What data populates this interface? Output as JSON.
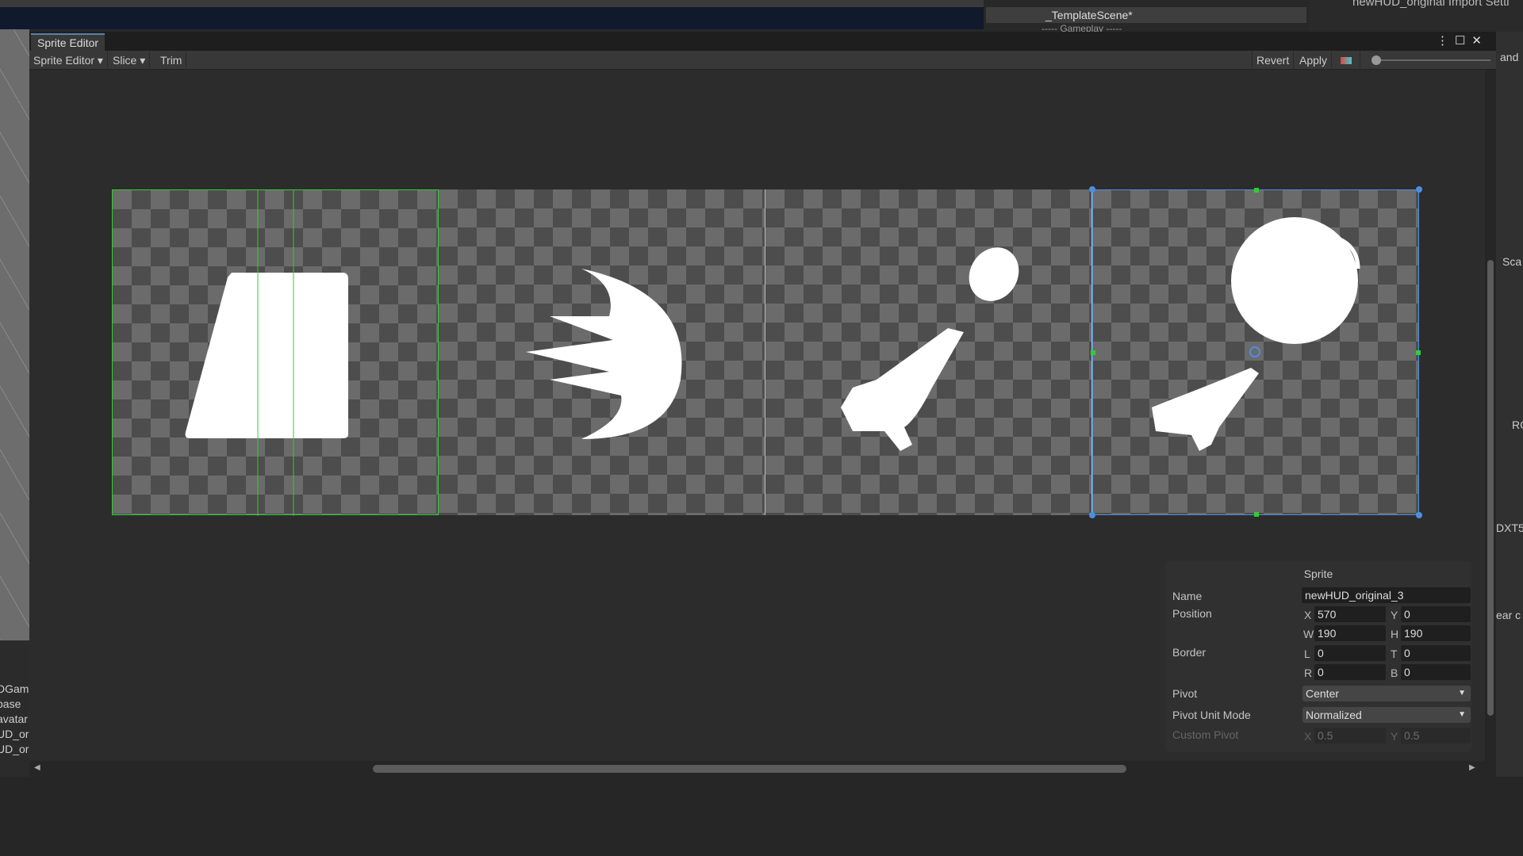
{
  "background": {
    "hierarchy_scene": "_TemplateScene*",
    "hierarchy_sub": "----- Gameplay -----",
    "inspector_title": "newHUD_original Import Setti",
    "project_items": [
      "DGam",
      "base",
      "avatar",
      "UD_or",
      "UD_or"
    ],
    "right_edge": [
      "and",
      "Sca",
      "RG",
      "DXT5",
      "ear c"
    ]
  },
  "window": {
    "tab_title": "Sprite Editor",
    "toolbar": {
      "mode": "Sprite Editor",
      "slice": "Slice",
      "trim": "Trim",
      "revert": "Revert",
      "apply": "Apply"
    },
    "zoom_level": 0
  },
  "sprite_panel": {
    "title": "Sprite",
    "name_label": "Name",
    "name": "newHUD_original_3",
    "position_label": "Position",
    "x": "570",
    "y": "0",
    "w": "190",
    "h": "190",
    "border_label": "Border",
    "l": "0",
    "t": "0",
    "r": "0",
    "b": "0",
    "pivot_label": "Pivot",
    "pivot": "Center",
    "pivot_unit_label": "Pivot Unit Mode",
    "pivot_unit": "Normalized",
    "custom_pivot_label": "Custom Pivot",
    "cx": "0.5",
    "cy": "0.5",
    "prefix": {
      "x": "X",
      "y": "Y",
      "w": "W",
      "h": "H",
      "l": "L",
      "t": "T",
      "r": "R",
      "b": "B"
    }
  },
  "colors": {
    "selection": "#4b8fe0",
    "outline": "#33cc33"
  }
}
